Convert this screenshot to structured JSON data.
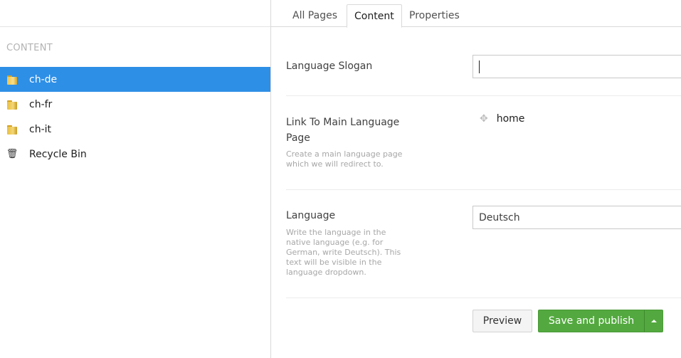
{
  "sidebar": {
    "section_title": "CONTENT",
    "items": [
      {
        "label": "ch-de",
        "icon": "folder-icon",
        "active": true
      },
      {
        "label": "ch-fr",
        "icon": "folder-icon",
        "active": false
      },
      {
        "label": "ch-it",
        "icon": "folder-icon",
        "active": false
      },
      {
        "label": "Recycle Bin",
        "icon": "trash-icon",
        "active": false
      }
    ]
  },
  "tabs": [
    {
      "label": "All Pages"
    },
    {
      "label": "Content",
      "active": true
    },
    {
      "label": "Properties"
    }
  ],
  "properties": {
    "slogan": {
      "label": "Language Slogan",
      "value": ""
    },
    "main_page": {
      "label": "Link To Main Language Page",
      "description": "Create a main language page which we will redirect to.",
      "value": "home"
    },
    "language": {
      "label": "Language",
      "description": "Write the language in the native language (e.g. for German, write Deutsch). This text will be visible in the language dropdown.",
      "value": "Deutsch"
    }
  },
  "actions": {
    "preview_label": "Preview",
    "save_publish_label": "Save and publish"
  },
  "colors": {
    "active_item": "#2e8fe6",
    "save_button": "#53a93f"
  }
}
